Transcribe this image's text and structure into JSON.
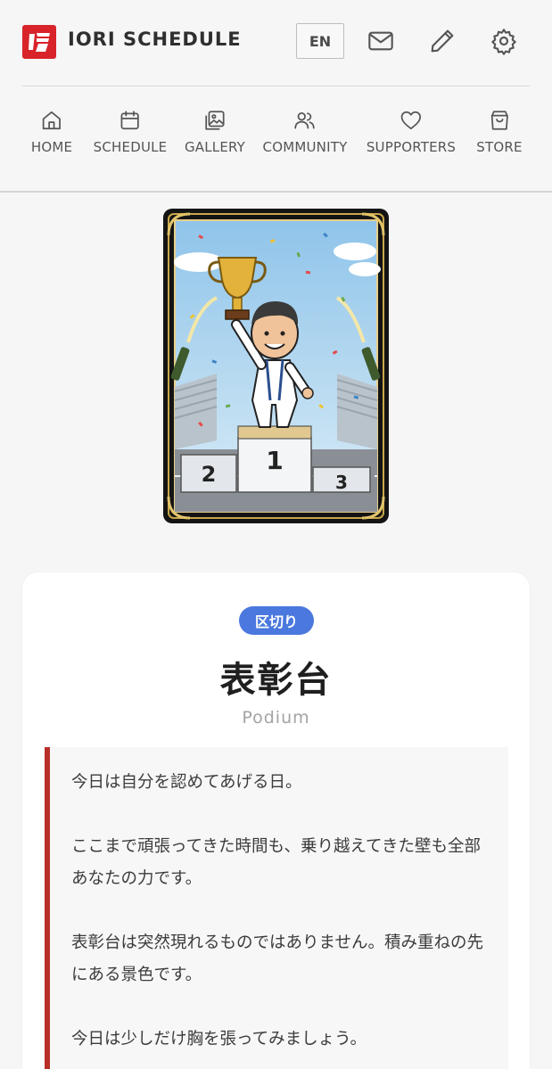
{
  "header": {
    "brand": "IORI SCHEDULE",
    "lang_label": "EN",
    "icons": [
      "mail-icon",
      "pencil-icon",
      "gear-icon"
    ]
  },
  "nav": {
    "items": [
      {
        "label": "HOME",
        "icon": "home-icon"
      },
      {
        "label": "SCHEDULE",
        "icon": "calendar-icon"
      },
      {
        "label": "GALLERY",
        "icon": "gallery-icon"
      },
      {
        "label": "COMMUNITY",
        "icon": "community-icon"
      },
      {
        "label": "SUPPORTERS",
        "icon": "heart-icon"
      },
      {
        "label": "STORE",
        "icon": "shopping-bag-icon"
      }
    ]
  },
  "card": {
    "podium_labels": [
      "2",
      "1",
      "3"
    ]
  },
  "article": {
    "tag": "区切り",
    "title": "表彰台",
    "subtitle": "Podium",
    "paragraphs": [
      "今日は自分を認めてあげる日。",
      "ここまで頑張ってきた時間も、乗り越えてきた壁も全部あなたの力です。",
      "表彰台は突然現れるものではありません。積み重ねの先にある景色です。",
      "今日は少しだけ胸を張ってみましょう。"
    ]
  },
  "colors": {
    "brand_red": "#d8232a",
    "tag_blue": "#4a78de",
    "quote_border": "#b73028"
  }
}
